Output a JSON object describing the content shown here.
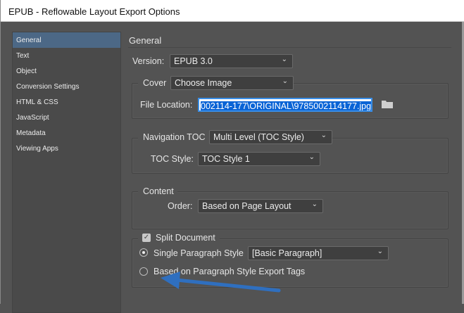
{
  "window": {
    "title": "EPUB - Reflowable Layout Export Options"
  },
  "sidebar": {
    "items": [
      {
        "label": "General",
        "selected": true
      },
      {
        "label": "Text"
      },
      {
        "label": "Object"
      },
      {
        "label": "Conversion Settings"
      },
      {
        "label": "HTML & CSS"
      },
      {
        "label": "JavaScript"
      },
      {
        "label": "Metadata"
      },
      {
        "label": "Viewing Apps"
      }
    ]
  },
  "main": {
    "title": "General",
    "version": {
      "label": "Version:",
      "value": "EPUB 3.0"
    },
    "cover": {
      "label": "Cover",
      "value": "Choose Image",
      "file_label": "File Location:",
      "file_value": "002114-177\\ORIGINAL\\9785002114177.jpg"
    },
    "nav": {
      "label": "Navigation TOC",
      "value": "Multi Level (TOC Style)",
      "toc_label": "TOC Style:",
      "toc_value": "TOC Style 1"
    },
    "content": {
      "label": "Content",
      "order_label": "Order:",
      "order_value": "Based on Page Layout"
    },
    "split": {
      "label": "Split Document",
      "checked": true,
      "single_label": "Single Paragraph Style",
      "single_value": "[Basic Paragraph]",
      "tags_label": "Based on Paragraph Style Export Tags"
    }
  },
  "annotation": {
    "arrow_color": "#2f6fbf"
  }
}
